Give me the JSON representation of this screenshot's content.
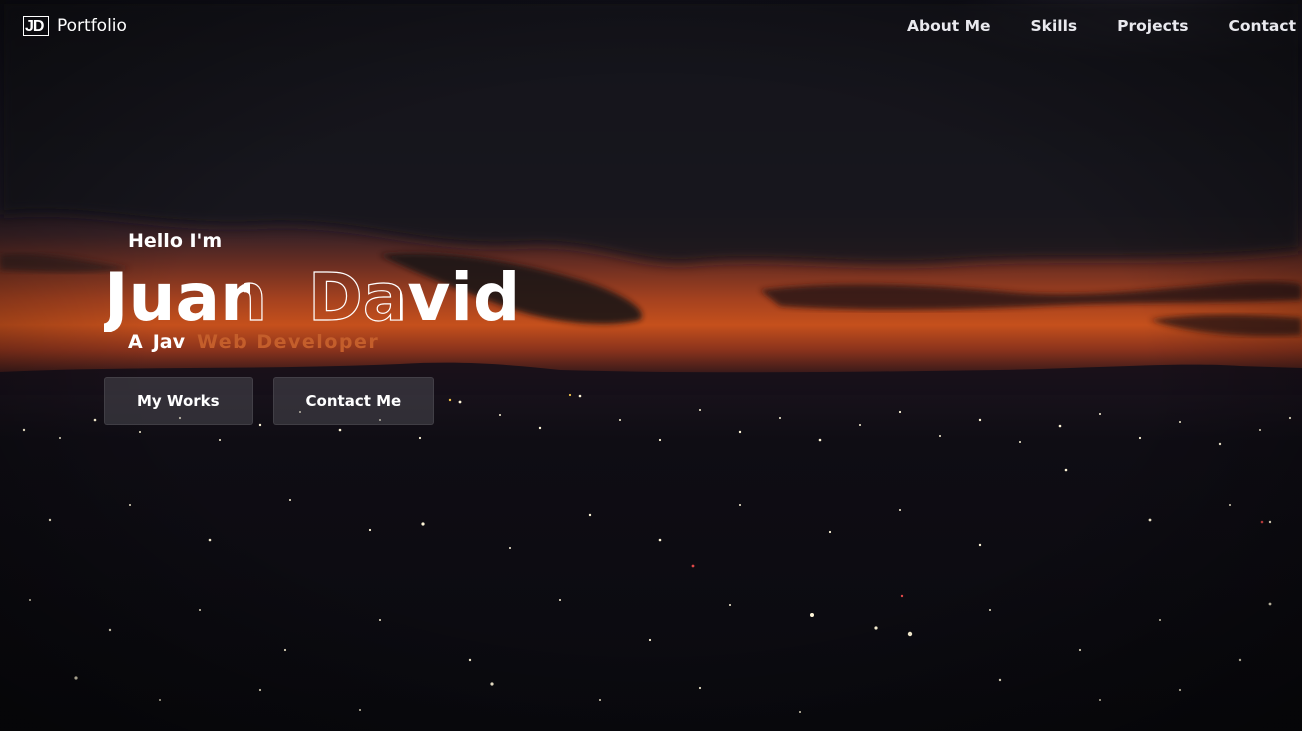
{
  "nav": {
    "logo_mark": "JD",
    "logo_text": "Portfolio",
    "links": [
      {
        "label": "About Me"
      },
      {
        "label": "Skills"
      },
      {
        "label": "Projects"
      },
      {
        "label": "Contact"
      }
    ]
  },
  "hero": {
    "greeting": "Hello I'm",
    "name_first": "Juan",
    "name_last": "David",
    "tagline_prefix": "A",
    "tagline_typed": "Jav",
    "tagline_accent": "Web Developer",
    "buttons": {
      "works": "My Works",
      "contact": "Contact Me"
    }
  },
  "colors": {
    "accent": "#c45e2b",
    "text": "#ffffff",
    "button_bg": "#5a5a62"
  }
}
